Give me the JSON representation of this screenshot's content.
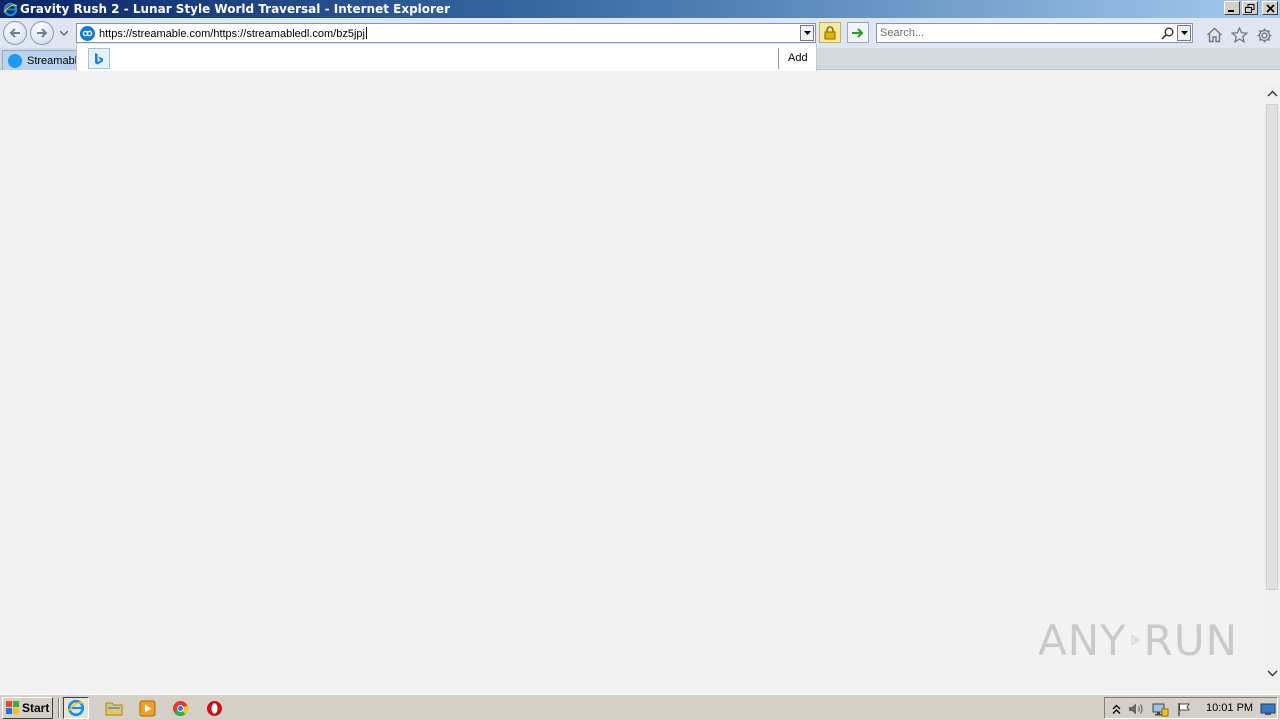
{
  "window": {
    "title": "Gravity Rush 2 - Lunar Style World Traversal - Internet Explorer"
  },
  "address_bar": {
    "url": "https://streamable.com/https://streamabledl.com/bz5jpj"
  },
  "search": {
    "placeholder": "Search..."
  },
  "tabs": [
    {
      "label": "Streamabl"
    }
  ],
  "autocomplete": {
    "add_label": "Add"
  },
  "taskbar": {
    "start_label": "Start",
    "clock": "10:01 PM"
  },
  "watermark": {
    "left": "ANY",
    "right": "RUN"
  },
  "colors": {
    "title_gradient_start": "#0a246a",
    "title_gradient_end": "#a6caf0",
    "tab_active": "#bcd3ef",
    "content_bg": "#f2f2f2",
    "taskbar_bg": "#d4d0c8"
  }
}
